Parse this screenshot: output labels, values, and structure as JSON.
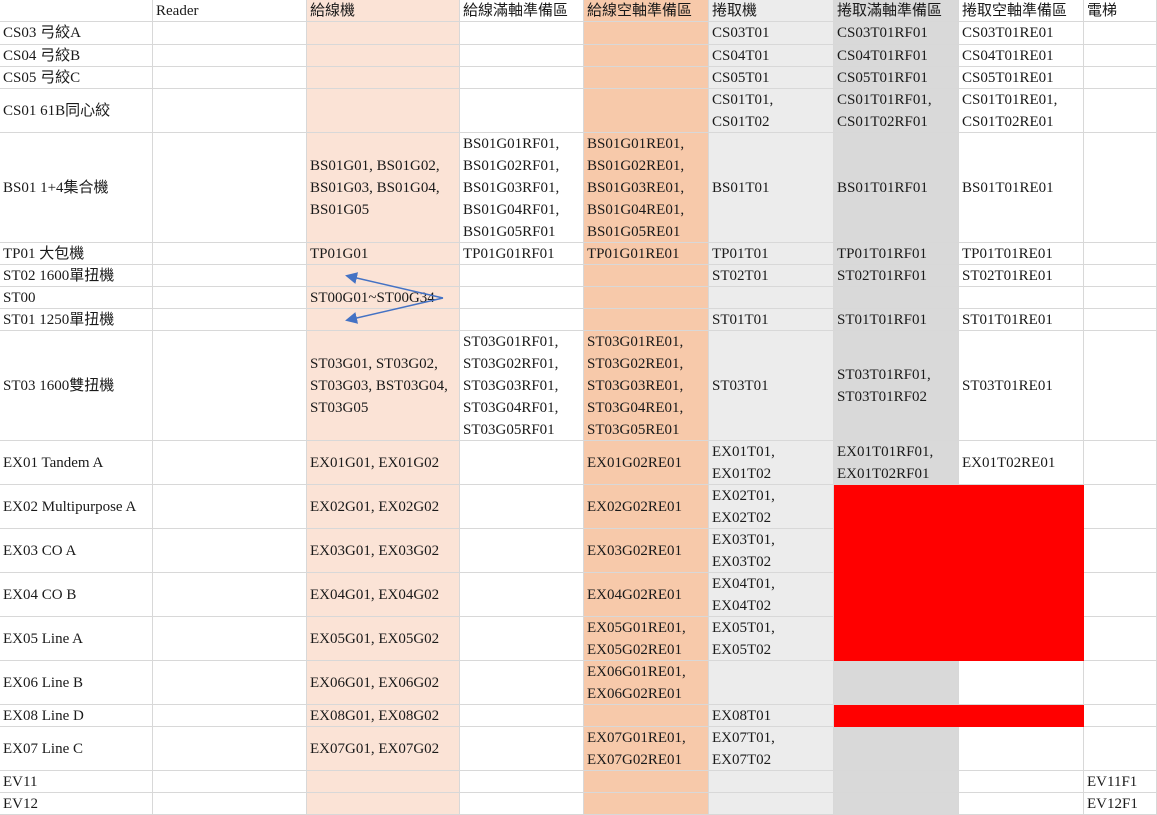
{
  "headers": [
    "",
    "Reader",
    "給線機",
    "給線滿軸準備區",
    "給線空軸準備區",
    "捲取機",
    "捲取滿軸準備區",
    "捲取空軸準備區",
    "電梯"
  ],
  "rows": [
    [
      "CS03 弓絞A",
      "",
      "",
      "",
      "",
      "CS03T01",
      "CS03T01RF01",
      "CS03T01RE01",
      ""
    ],
    [
      "CS04 弓絞B",
      "",
      "",
      "",
      "",
      "CS04T01",
      "CS04T01RF01",
      "CS04T01RE01",
      ""
    ],
    [
      "CS05 弓絞C",
      "",
      "",
      "",
      "",
      "CS05T01",
      "CS05T01RF01",
      "CS05T01RE01",
      ""
    ],
    [
      "CS01 61B同心絞",
      "",
      "",
      "",
      "",
      "CS01T01,\nCS01T02",
      "CS01T01RF01,\nCS01T02RF01",
      "CS01T01RE01,\nCS01T02RE01",
      ""
    ],
    [
      "BS01 1+4集合機",
      "",
      "BS01G01, BS01G02,\nBS01G03, BS01G04,\nBS01G05",
      "BS01G01RF01,\nBS01G02RF01,\nBS01G03RF01,\nBS01G04RF01,\nBS01G05RF01",
      "BS01G01RE01,\nBS01G02RE01,\nBS01G03RE01,\nBS01G04RE01,\nBS01G05RE01",
      "BS01T01",
      "BS01T01RF01",
      "BS01T01RE01",
      ""
    ],
    [
      "TP01 大包機",
      "",
      "TP01G01",
      "TP01G01RF01",
      "TP01G01RE01",
      "TP01T01",
      "TP01T01RF01",
      "TP01T01RE01",
      ""
    ],
    [
      "ST02 1600單扭機",
      "",
      "",
      "",
      "",
      "ST02T01",
      "ST02T01RF01",
      "ST02T01RE01",
      ""
    ],
    [
      "ST00",
      "",
      "ST00G01~ST00G34",
      "",
      "",
      "",
      "",
      "",
      ""
    ],
    [
      "ST01 1250單扭機",
      "",
      "",
      "",
      "",
      "ST01T01",
      "ST01T01RF01",
      "ST01T01RE01",
      ""
    ],
    [
      "ST03 1600雙扭機",
      "",
      "ST03G01, ST03G02,\nST03G03, BST03G04,\nST03G05",
      "ST03G01RF01,\nST03G02RF01,\nST03G03RF01,\nST03G04RF01,\nST03G05RF01",
      "ST03G01RE01,\nST03G02RE01,\nST03G03RE01,\nST03G04RE01,\nST03G05RE01",
      "ST03T01",
      "ST03T01RF01,\nST03T01RF02",
      "ST03T01RE01",
      ""
    ],
    [
      "EX01 Tandem A",
      "",
      "EX01G01, EX01G02",
      "",
      "EX01G02RE01",
      "EX01T01,\nEX01T02",
      "EX01T01RF01,\nEX01T02RF01",
      "EX01T02RE01",
      ""
    ],
    [
      "EX02 Multipurpose A",
      "",
      "EX02G01, EX02G02",
      "",
      "EX02G02RE01",
      "EX02T01,\nEX02T02",
      "",
      "",
      ""
    ],
    [
      "EX03 CO A",
      "",
      "EX03G01, EX03G02",
      "",
      "EX03G02RE01",
      "EX03T01,\nEX03T02",
      "",
      "",
      ""
    ],
    [
      "EX04 CO B",
      "",
      "EX04G01, EX04G02",
      "",
      "EX04G02RE01",
      "EX04T01,\nEX04T02",
      "",
      "",
      ""
    ],
    [
      "EX05 Line A",
      "",
      "EX05G01, EX05G02",
      "",
      "EX05G01RE01,\nEX05G02RE01",
      "EX05T01,\nEX05T02",
      "",
      "",
      ""
    ],
    [
      "EX06 Line B",
      "",
      "EX06G01, EX06G02",
      "",
      "EX06G01RE01,\nEX06G02RE01",
      "",
      "",
      "",
      ""
    ],
    [
      "EX08 Line D",
      "",
      "EX08G01, EX08G02",
      "",
      "",
      "EX08T01",
      "",
      "",
      ""
    ],
    [
      "EX07 Line C",
      "",
      "EX07G01, EX07G02",
      "",
      "EX07G01RE01,\nEX07G02RE01",
      "EX07T01,\nEX07T02",
      "",
      "",
      ""
    ],
    [
      "EV11",
      "",
      "",
      "",
      "",
      "",
      "",
      "",
      "EV11F1"
    ],
    [
      "EV12",
      "",
      "",
      "",
      "",
      "",
      "",
      "",
      "EV12F1"
    ]
  ],
  "highlight_color": "#ff0000",
  "column_colors": {
    "給線機": "#fbe3d6",
    "給線空軸準備區": "#f7c9aa",
    "捲取機": "#ececec",
    "捲取滿軸準備區": "#d9d9d9"
  }
}
